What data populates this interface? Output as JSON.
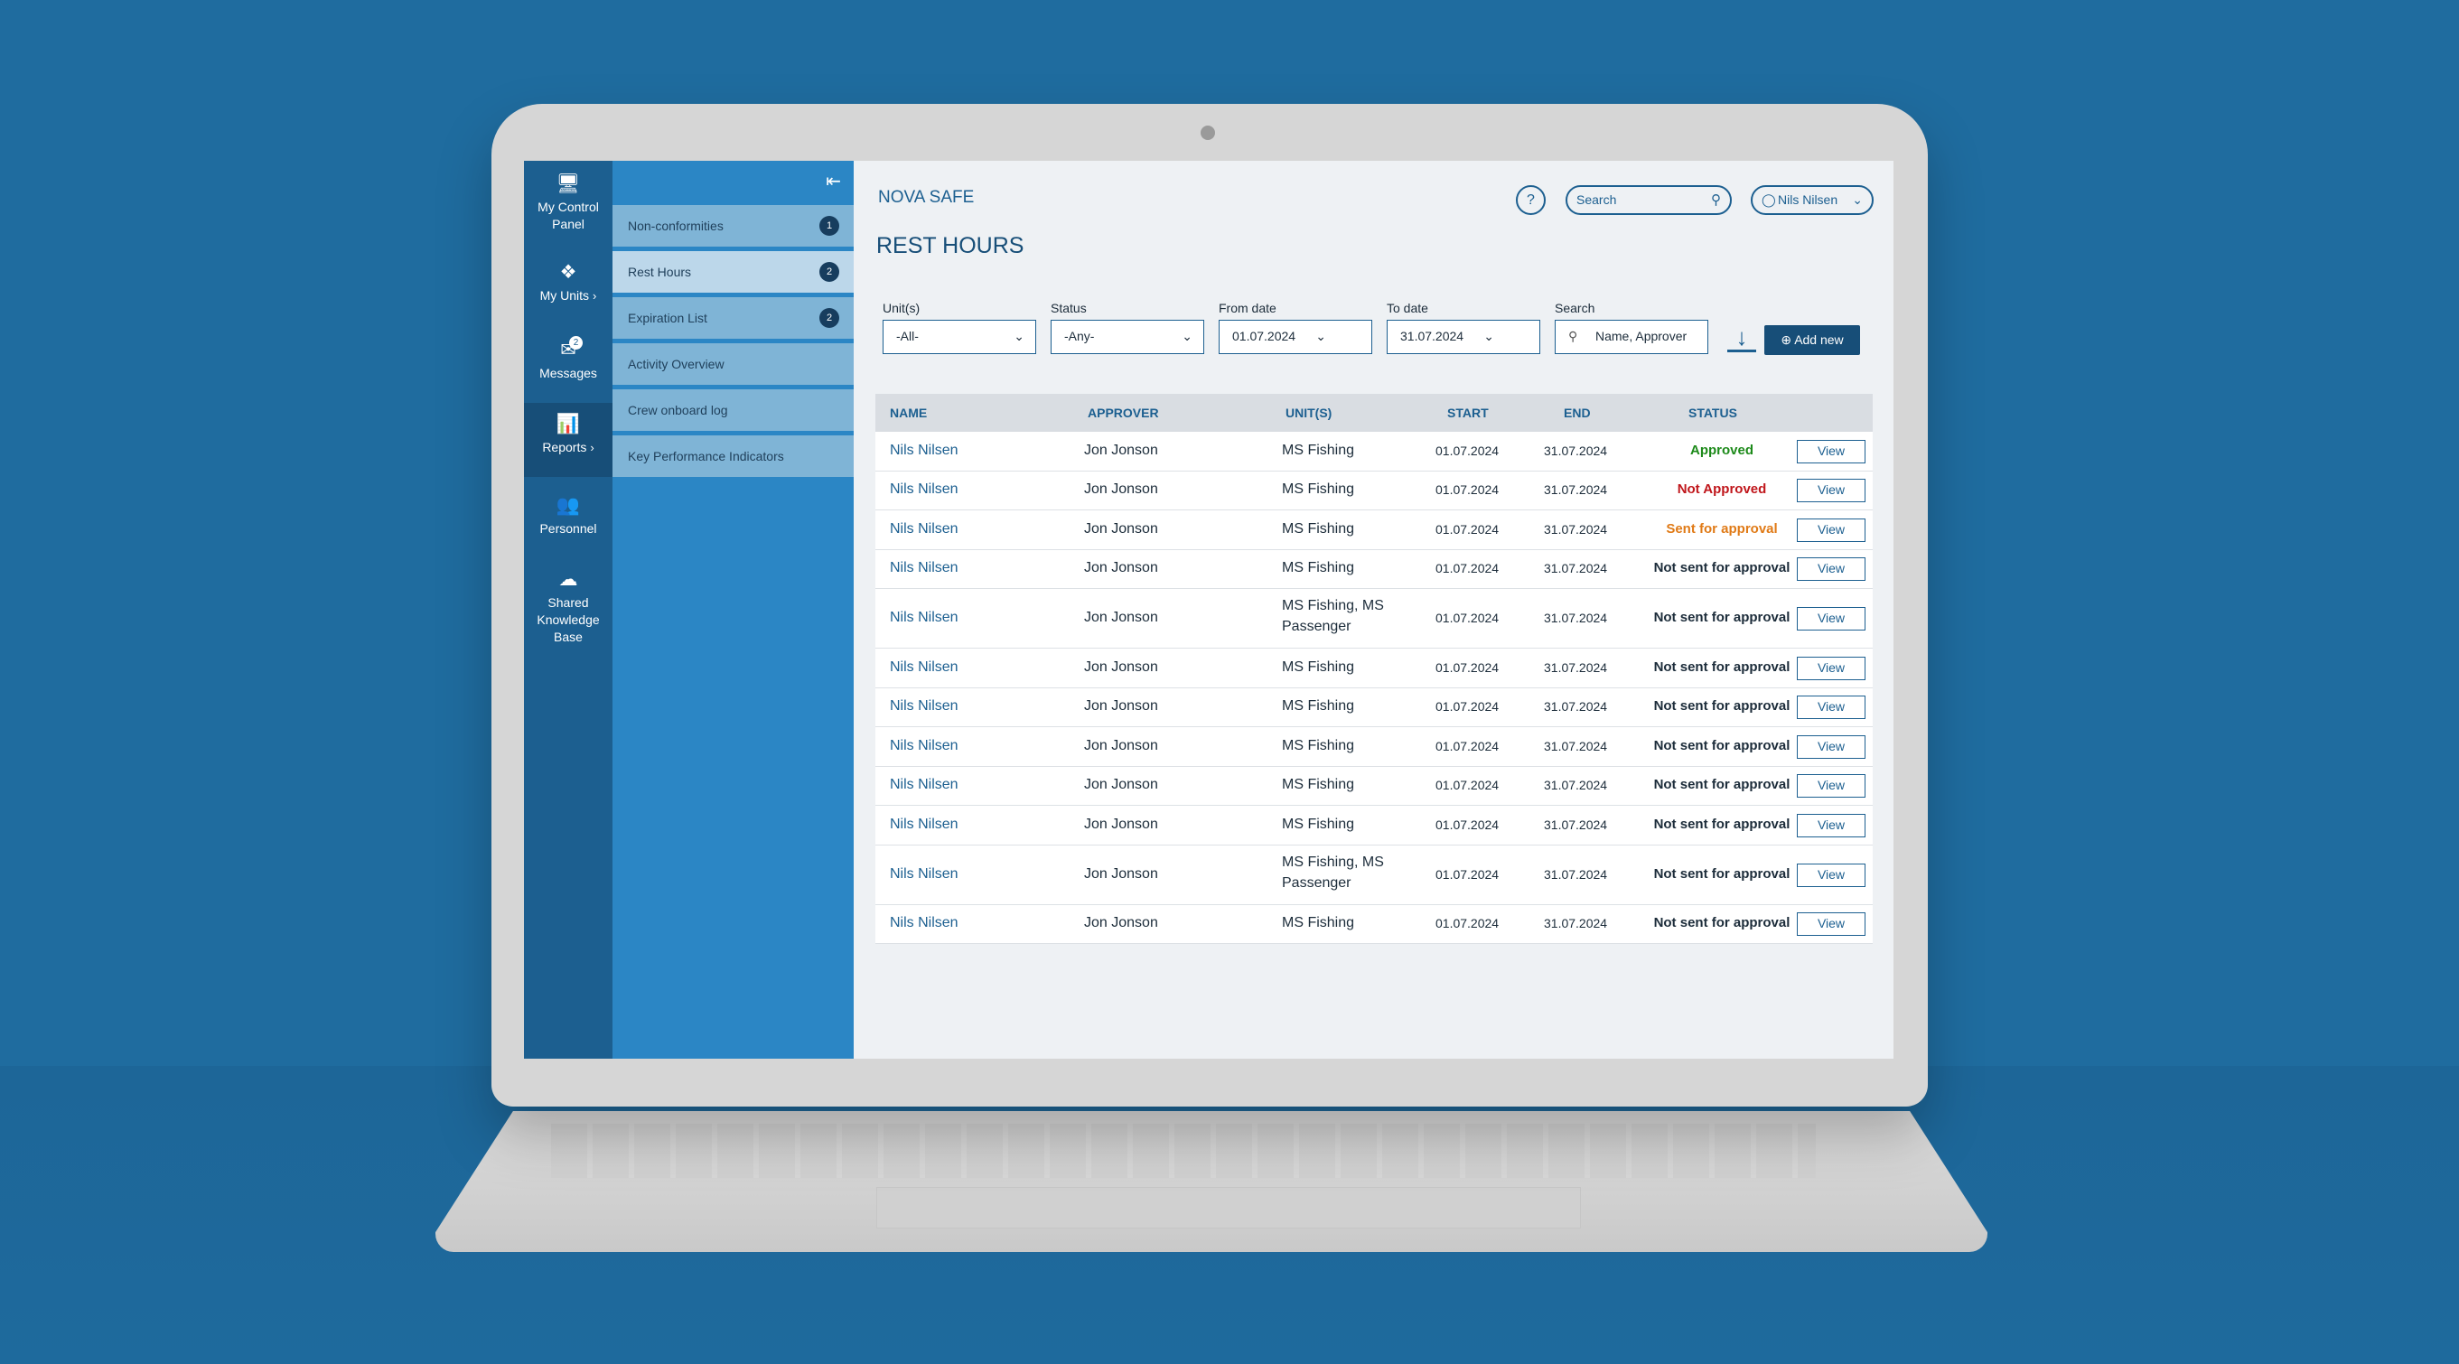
{
  "app": {
    "brand": "NOVA SAFE",
    "page_title": "REST HOURS"
  },
  "rail": [
    {
      "label": "My Control Panel",
      "icon": "monitor-icon"
    },
    {
      "label": "My Units",
      "icon": "units-icon"
    },
    {
      "label": "Messages",
      "icon": "messages-icon",
      "badge": "2"
    },
    {
      "label": "Reports",
      "icon": "reports-icon"
    },
    {
      "label": "Personnel",
      "icon": "personnel-icon"
    },
    {
      "label": "Shared Knowledge Base",
      "icon": "cloud-icon"
    }
  ],
  "submenu": [
    {
      "label": "Non-conformities",
      "badge": "1"
    },
    {
      "label": "Rest Hours",
      "badge": "2"
    },
    {
      "label": "Expiration List",
      "badge": "2"
    },
    {
      "label": "Activity Overview"
    },
    {
      "label": "Crew onboard log"
    },
    {
      "label": "Key Performance Indicators"
    }
  ],
  "header": {
    "help": "?",
    "search_placeholder": "Search",
    "user": "Nils Nilsen"
  },
  "filters": {
    "units_label": "Unit(s)",
    "units_value": "-All-",
    "status_label": "Status",
    "status_value": "-Any-",
    "from_label": "From date",
    "from_value": "01.07.2024",
    "to_label": "To date",
    "to_value": "31.07.2024",
    "search_label": "Search",
    "search_placeholder": "Name, Approver",
    "add_new": "Add new"
  },
  "table": {
    "columns": [
      "NAME",
      "APPROVER",
      "UNIT(S)",
      "START",
      "END",
      "STATUS"
    ],
    "view_label": "View",
    "rows": [
      {
        "name": "Nils Nilsen",
        "approver": "Jon Jonson",
        "unit": "MS Fishing",
        "start": "01.07.2024",
        "end": "31.07.2024",
        "status": "Approved"
      },
      {
        "name": "Nils Nilsen",
        "approver": "Jon Jonson",
        "unit": "MS Fishing",
        "start": "01.07.2024",
        "end": "31.07.2024",
        "status": "Not Approved"
      },
      {
        "name": "Nils Nilsen",
        "approver": "Jon Jonson",
        "unit": "MS Fishing",
        "start": "01.07.2024",
        "end": "31.07.2024",
        "status": "Sent for approval"
      },
      {
        "name": "Nils Nilsen",
        "approver": "Jon Jonson",
        "unit": "MS Fishing",
        "start": "01.07.2024",
        "end": "31.07.2024",
        "status": "Not sent for approval"
      },
      {
        "name": "Nils Nilsen",
        "approver": "Jon Jonson",
        "unit": "MS Fishing, MS",
        "unit2": "Passenger",
        "start": "01.07.2024",
        "end": "31.07.2024",
        "status": "Not sent for approval"
      },
      {
        "name": "Nils Nilsen",
        "approver": "Jon Jonson",
        "unit": "MS Fishing",
        "start": "01.07.2024",
        "end": "31.07.2024",
        "status": "Not sent for approval"
      },
      {
        "name": "Nils Nilsen",
        "approver": "Jon Jonson",
        "unit": "MS Fishing",
        "start": "01.07.2024",
        "end": "31.07.2024",
        "status": "Not sent for approval"
      },
      {
        "name": "Nils Nilsen",
        "approver": "Jon Jonson",
        "unit": "MS Fishing",
        "start": "01.07.2024",
        "end": "31.07.2024",
        "status": "Not sent for approval"
      },
      {
        "name": "Nils Nilsen",
        "approver": "Jon Jonson",
        "unit": "MS Fishing",
        "start": "01.07.2024",
        "end": "31.07.2024",
        "status": "Not sent for approval"
      },
      {
        "name": "Nils Nilsen",
        "approver": "Jon Jonson",
        "unit": "MS Fishing",
        "start": "01.07.2024",
        "end": "31.07.2024",
        "status": "Not sent for approval"
      },
      {
        "name": "Nils Nilsen",
        "approver": "Jon Jonson",
        "unit": "MS Fishing, MS",
        "unit2": "Passenger",
        "start": "01.07.2024",
        "end": "31.07.2024",
        "status": "Not sent for approval"
      },
      {
        "name": "Nils Nilsen",
        "approver": "Jon Jonson",
        "unit": "MS Fishing",
        "start": "01.07.2024",
        "end": "31.07.2024",
        "status": "Not sent for approval"
      }
    ]
  },
  "colors": {
    "approved": "#1d8a1a",
    "not_approved": "#c0161b",
    "sent": "#e07a16",
    "primary": "#1c5f90"
  }
}
